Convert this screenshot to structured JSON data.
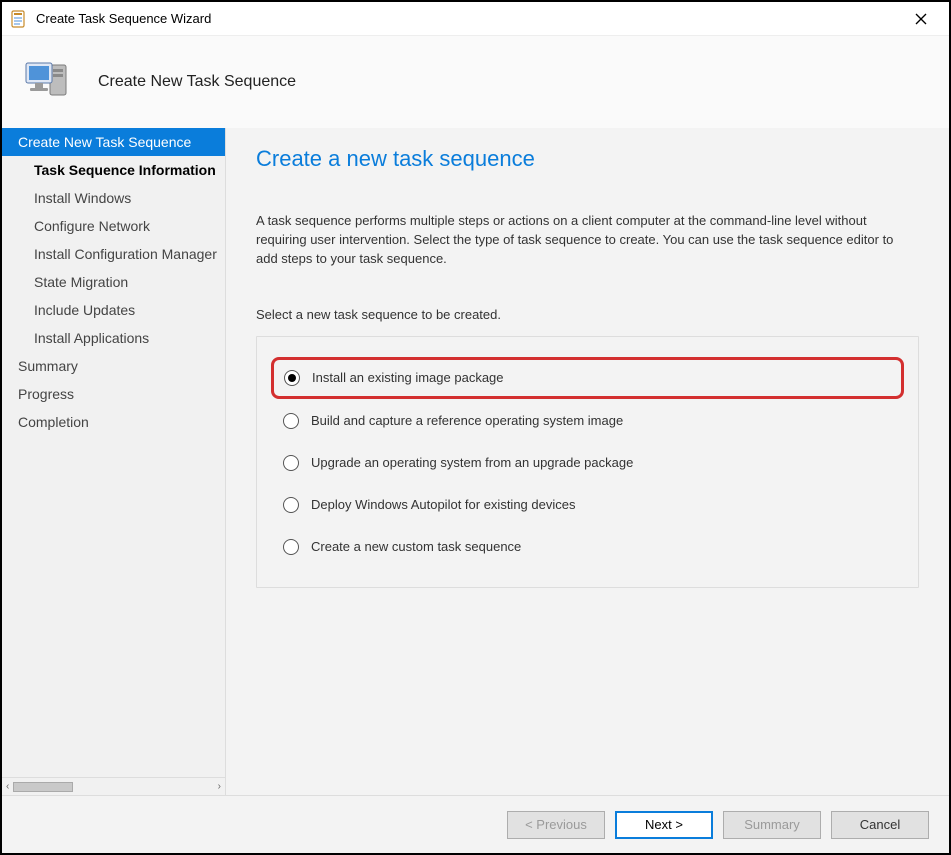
{
  "window_title": "Create Task Sequence Wizard",
  "header": {
    "title": "Create New Task Sequence"
  },
  "sidebar": {
    "items": [
      {
        "label": "Create New Task Sequence",
        "level": 0,
        "selected": true
      },
      {
        "label": "Task Sequence Information",
        "level": 1,
        "current": true
      },
      {
        "label": "Install Windows",
        "level": 1
      },
      {
        "label": "Configure Network",
        "level": 1
      },
      {
        "label": "Install Configuration Manager",
        "level": 1
      },
      {
        "label": "State Migration",
        "level": 1
      },
      {
        "label": "Include Updates",
        "level": 1
      },
      {
        "label": "Install Applications",
        "level": 1
      },
      {
        "label": "Summary",
        "level": 0
      },
      {
        "label": "Progress",
        "level": 0
      },
      {
        "label": "Completion",
        "level": 0
      }
    ]
  },
  "content": {
    "page_title": "Create a new task sequence",
    "description": "A task sequence performs multiple steps or actions on a client computer at the command-line level without requiring user intervention. Select the type of task sequence to create. You can use the task sequence editor to add steps to your task sequence.",
    "group_label": "Select a new task sequence to be created.",
    "options": [
      {
        "label": "Install an existing image package",
        "checked": true,
        "highlighted": true
      },
      {
        "label": "Build and capture a reference operating system image",
        "checked": false
      },
      {
        "label": "Upgrade an operating system from an upgrade package",
        "checked": false
      },
      {
        "label": "Deploy Windows Autopilot for existing devices",
        "checked": false
      },
      {
        "label": "Create a new custom task sequence",
        "checked": false
      }
    ]
  },
  "footer": {
    "previous": "< Previous",
    "next": "Next >",
    "summary": "Summary",
    "cancel": "Cancel"
  }
}
